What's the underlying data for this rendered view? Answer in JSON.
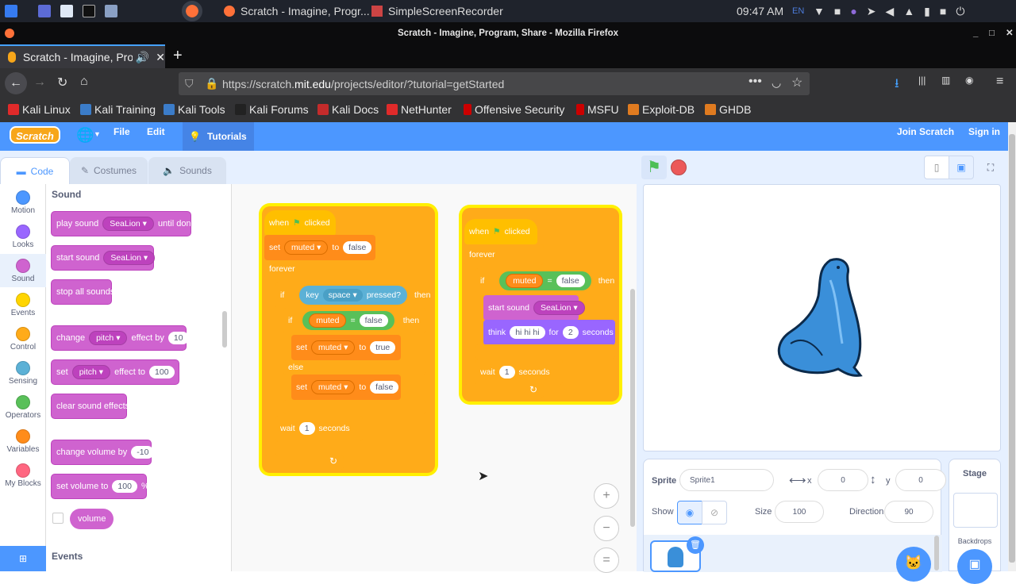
{
  "taskbar": {
    "windows": [
      {
        "label": "Scratch - Imagine, Progr..."
      },
      {
        "label": "SimpleScreenRecorder"
      }
    ],
    "time": "09:47 AM",
    "lang": "EN"
  },
  "browser": {
    "window_title": "Scratch - Imagine, Program, Share - Mozilla Firefox",
    "tab_label": "Scratch - Imagine, Pro",
    "url_prefix": "https://scratch.",
    "url_domain": "mit.edu",
    "url_path": "/projects/editor/?tutorial=getStarted"
  },
  "bookmarks": [
    "Kali Linux",
    "Kali Training",
    "Kali Tools",
    "Kali Forums",
    "Kali Docs",
    "NetHunter",
    "Offensive Security",
    "MSFU",
    "Exploit-DB",
    "GHDB"
  ],
  "scratch_menu": {
    "logo": "Scratch",
    "file": "File",
    "edit": "Edit",
    "tutorials": "Tutorials",
    "join": "Join Scratch",
    "signin": "Sign in"
  },
  "editor_tabs": {
    "code": "Code",
    "costumes": "Costumes",
    "sounds": "Sounds"
  },
  "categories": [
    {
      "label": "Motion",
      "color": "#4c97ff"
    },
    {
      "label": "Looks",
      "color": "#9966ff"
    },
    {
      "label": "Sound",
      "color": "#cf63cf"
    },
    {
      "label": "Events",
      "color": "#ffd500"
    },
    {
      "label": "Control",
      "color": "#ffab19"
    },
    {
      "label": "Sensing",
      "color": "#5cb1d6"
    },
    {
      "label": "Operators",
      "color": "#59c059"
    },
    {
      "label": "Variables",
      "color": "#ff8c1a"
    },
    {
      "label": "My Blocks",
      "color": "#ff6680"
    }
  ],
  "palette": {
    "heading": "Sound",
    "events_heading": "Events",
    "play_sound": "play sound",
    "sealion": "SeaLion",
    "until_done": "until done",
    "start_sound": "start sound",
    "stop_all": "stop all sounds",
    "change": "change",
    "pitch": "pitch",
    "effect_by": "effect by",
    "ten": "10",
    "set": "set",
    "effect_to": "effect to",
    "hundred": "100",
    "clear_effects": "clear sound effects",
    "change_volume_by": "change volume by",
    "minus_ten": "-10",
    "set_volume_to": "set volume to",
    "percent": "%",
    "volume": "volume"
  },
  "script1": {
    "when": "when",
    "clicked": "clicked",
    "set": "set",
    "muted": "muted",
    "to": "to",
    "false": "false",
    "forever": "forever",
    "if": "if",
    "key": "key",
    "space": "space",
    "pressed": "pressed?",
    "then": "then",
    "eq": "=",
    "true": "true",
    "else": "else",
    "wait": "wait",
    "one": "1",
    "seconds": "seconds"
  },
  "script2": {
    "when": "when",
    "clicked": "clicked",
    "forever": "forever",
    "if": "if",
    "muted": "muted",
    "eq": "=",
    "false": "false",
    "then": "then",
    "start_sound": "start sound",
    "sealion": "SeaLion",
    "think": "think",
    "hihihi": "hi hi hi",
    "for": "for",
    "two": "2",
    "seconds": "seconds",
    "wait": "wait",
    "one": "1"
  },
  "zoom": {
    "in": "+",
    "out": "−",
    "reset": "="
  },
  "sprite_info": {
    "sprite_label": "Sprite",
    "sprite_name": "Sprite1",
    "x_label": "x",
    "x": "0",
    "y_label": "y",
    "y": "0",
    "show_label": "Show",
    "size_label": "Size",
    "size": "100",
    "direction_label": "Direction",
    "direction": "90"
  },
  "stage_pane": {
    "title": "Stage",
    "backdrops": "Backdrops"
  }
}
